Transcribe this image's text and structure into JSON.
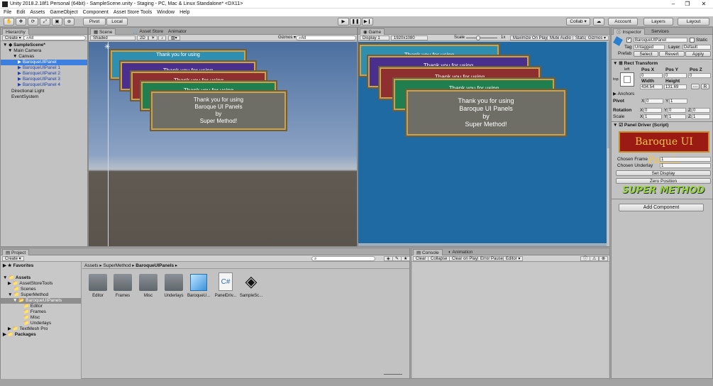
{
  "titlebar": {
    "title": "Unity 2018.2.18f1 Personal (64bit) - SampleScene.unity - Staging - PC, Mac & Linux Standalone* <DX11>",
    "minimize": "–",
    "maximize": "❐",
    "close": "✕"
  },
  "menu": [
    "File",
    "Edit",
    "Assets",
    "GameObject",
    "Component",
    "Asset Store Tools",
    "Window",
    "Help"
  ],
  "toolbar": {
    "pivot": "Pivot",
    "local": "Local",
    "collab": "Collab ▾",
    "account": "Account",
    "layers": "Layers",
    "layout": "Layout"
  },
  "hierarchy": {
    "tab": "Hierarchy",
    "create": "Create ▾",
    "search": "All",
    "rows": [
      {
        "label": "SampleScene*"
      },
      {
        "label": "Main Camera"
      },
      {
        "label": "Canvas"
      },
      {
        "label": "BaroqueUIPanel"
      },
      {
        "label": "BaroqueUIPanel 1"
      },
      {
        "label": "BaroqueUIPanel 2"
      },
      {
        "label": "BaroqueUIPanel 3"
      },
      {
        "label": "BaroqueUIPanel 4"
      },
      {
        "label": "Directional Light"
      },
      {
        "label": "EventSystem"
      }
    ]
  },
  "scene": {
    "tabs": [
      "Scene",
      "Asset Store",
      "Animator"
    ],
    "shaded": "Shaded",
    "mode2d": "2D",
    "gizmos": "Gizmos ▾",
    "search": "All"
  },
  "game": {
    "tab": "Game",
    "display": "Display 1",
    "resolution": "1920x1080",
    "scale": "Scale",
    "scale_value": "1x",
    "options": [
      "Maximize On Play",
      "Mute Audio",
      "Stats",
      "Gizmos ▾"
    ]
  },
  "card": {
    "line1": "Thank you for using",
    "line2": "Baroque UI Panels",
    "line3": "by",
    "line4": "Super Method!"
  },
  "card_colors": [
    "#2f8fb0",
    "#4a2f8f",
    "#8f2f2f",
    "#1f7f4f",
    "#6e6e66"
  ],
  "inspector": {
    "tabs": [
      "Inspector",
      "Services"
    ],
    "name": "BaroqueUIPanel",
    "static": "Static",
    "tag_label": "Tag",
    "tag": "Untagged",
    "layer_label": "Layer",
    "layer": "Default",
    "prefab_label": "Prefab",
    "prefab_select": "Select",
    "prefab_revert": "Revert",
    "prefab_apply": "Apply",
    "rect_transform": "Rect Transform",
    "left": "left",
    "top": "top",
    "posx_label": "Pos X",
    "posy_label": "Pos Y",
    "posz_label": "Pos Z",
    "posx": "0",
    "posy": "0",
    "posz": "0",
    "width_label": "Width",
    "height_label": "Height",
    "width": "434.54",
    "height": "131.69",
    "r_button": "R",
    "anchors": "Anchors",
    "pivot": "Pivot",
    "pivot_x": "0",
    "pivot_y": "1",
    "rotation": "Rotation",
    "rot_x": "0",
    "rot_y": "0",
    "rot_z": "0",
    "scale": "Scale",
    "scale_x": "1",
    "scale_y": "1",
    "scale_z": "1",
    "x": "X",
    "y": "Y",
    "z": "Z",
    "panel_driver": "Panel Driver (Script)",
    "banner": "Baroque UI Panels",
    "chosen_frame": "Chosen Frame",
    "chosen_frame_value": "1",
    "chosen_underlay": "Chosen Underlay",
    "chosen_underlay_value": "1",
    "set_display": "Set Display",
    "zero_position": "Zero Position",
    "super_method": "SUPER METHOD",
    "add_component": "Add Component"
  },
  "project": {
    "tab": "Project",
    "create": "Create ▾",
    "favorites": "Favorites",
    "assets": "Assets",
    "tree": [
      "AssetStoreTools",
      "Scenes",
      "SuperMethod",
      "BaroqueUIPanels",
      "Editor",
      "Frames",
      "Misc",
      "Underlays",
      "TextMesh Pro"
    ],
    "packages": "Packages",
    "breadcrumb": [
      "Assets",
      "SuperMethod",
      "BaroqueUIPanels"
    ],
    "items": [
      "Editor",
      "Frames",
      "Misc",
      "Underlays",
      "BaroqueU...",
      "PanelDriv...",
      "SampleSc..."
    ]
  },
  "console": {
    "tabs": [
      "Console",
      "Animation"
    ],
    "buttons": [
      "Clear",
      "Collapse",
      "Clear on Play",
      "Error Pause",
      "Editor ▾"
    ]
  }
}
